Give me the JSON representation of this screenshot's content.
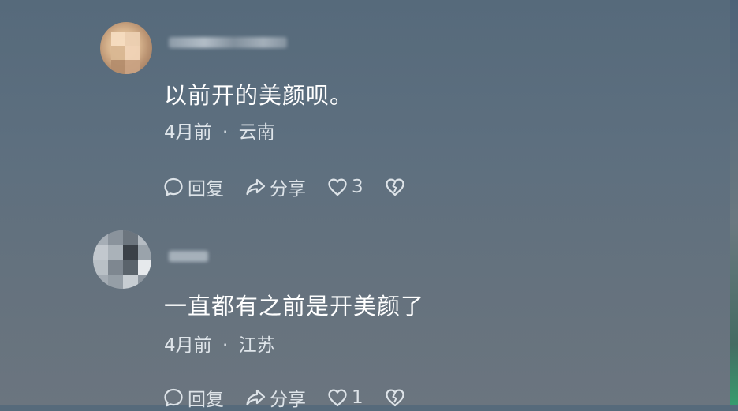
{
  "comments": [
    {
      "text": "以前开的美颜呗。",
      "time": "4月前",
      "separator": "·",
      "location": "云南",
      "reply_label": "回复",
      "share_label": "分享",
      "like_count": "3"
    },
    {
      "text": "一直都有之前是开美颜了",
      "time": "4月前",
      "separator": "·",
      "location": "江苏",
      "reply_label": "回复",
      "share_label": "分享",
      "like_count": "1"
    }
  ],
  "icons": {
    "reply": "speech-bubble-icon",
    "share": "share-arrow-icon",
    "like": "heart-icon",
    "dislike": "broken-heart-icon"
  },
  "colors": {
    "text_primary": "#ffffff",
    "text_secondary": "#dfe5ea",
    "background": "#5d6f7f"
  }
}
